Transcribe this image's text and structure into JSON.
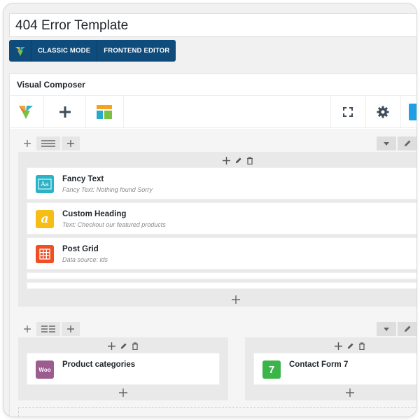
{
  "page": {
    "title": "404 Error Template"
  },
  "mode_bar": {
    "logo_icon": "vc-logo-icon",
    "classic_label": "CLASSIC MODE",
    "frontend_label": "FRONTEND EDITOR",
    "color": "#0f4c7c"
  },
  "composer": {
    "title": "Visual Composer",
    "toolbar": {
      "icons": [
        "vc-logo-icon",
        "plus-icon",
        "templates-icon",
        "fullscreen-icon",
        "gear-icon"
      ]
    }
  },
  "rows": [
    {
      "elements": [
        {
          "title": "Fancy Text",
          "subtitle": "Fancy Text: Nothing found Sorry",
          "icon": "fancy-text-icon",
          "icon_color": "#2ab3c6"
        },
        {
          "title": "Custom Heading",
          "subtitle": "Text: Checkout our featured products",
          "icon": "custom-heading-icon",
          "icon_color": "#f6bd16",
          "icon_glyph": "a"
        },
        {
          "title": "Post Grid",
          "subtitle": "Data source: ids",
          "icon": "post-grid-icon",
          "icon_color": "#f04e23"
        }
      ]
    },
    {
      "columns": [
        {
          "elements": [
            {
              "title": "Product categories",
              "icon": "woocommerce-icon",
              "icon_color": "#9b5c8f",
              "icon_glyph": "Woo"
            }
          ]
        },
        {
          "elements": [
            {
              "title": "Contact Form 7",
              "icon": "contact-form-7-icon",
              "icon_color": "#3bb54a",
              "icon_glyph": "7"
            }
          ]
        }
      ]
    }
  ]
}
